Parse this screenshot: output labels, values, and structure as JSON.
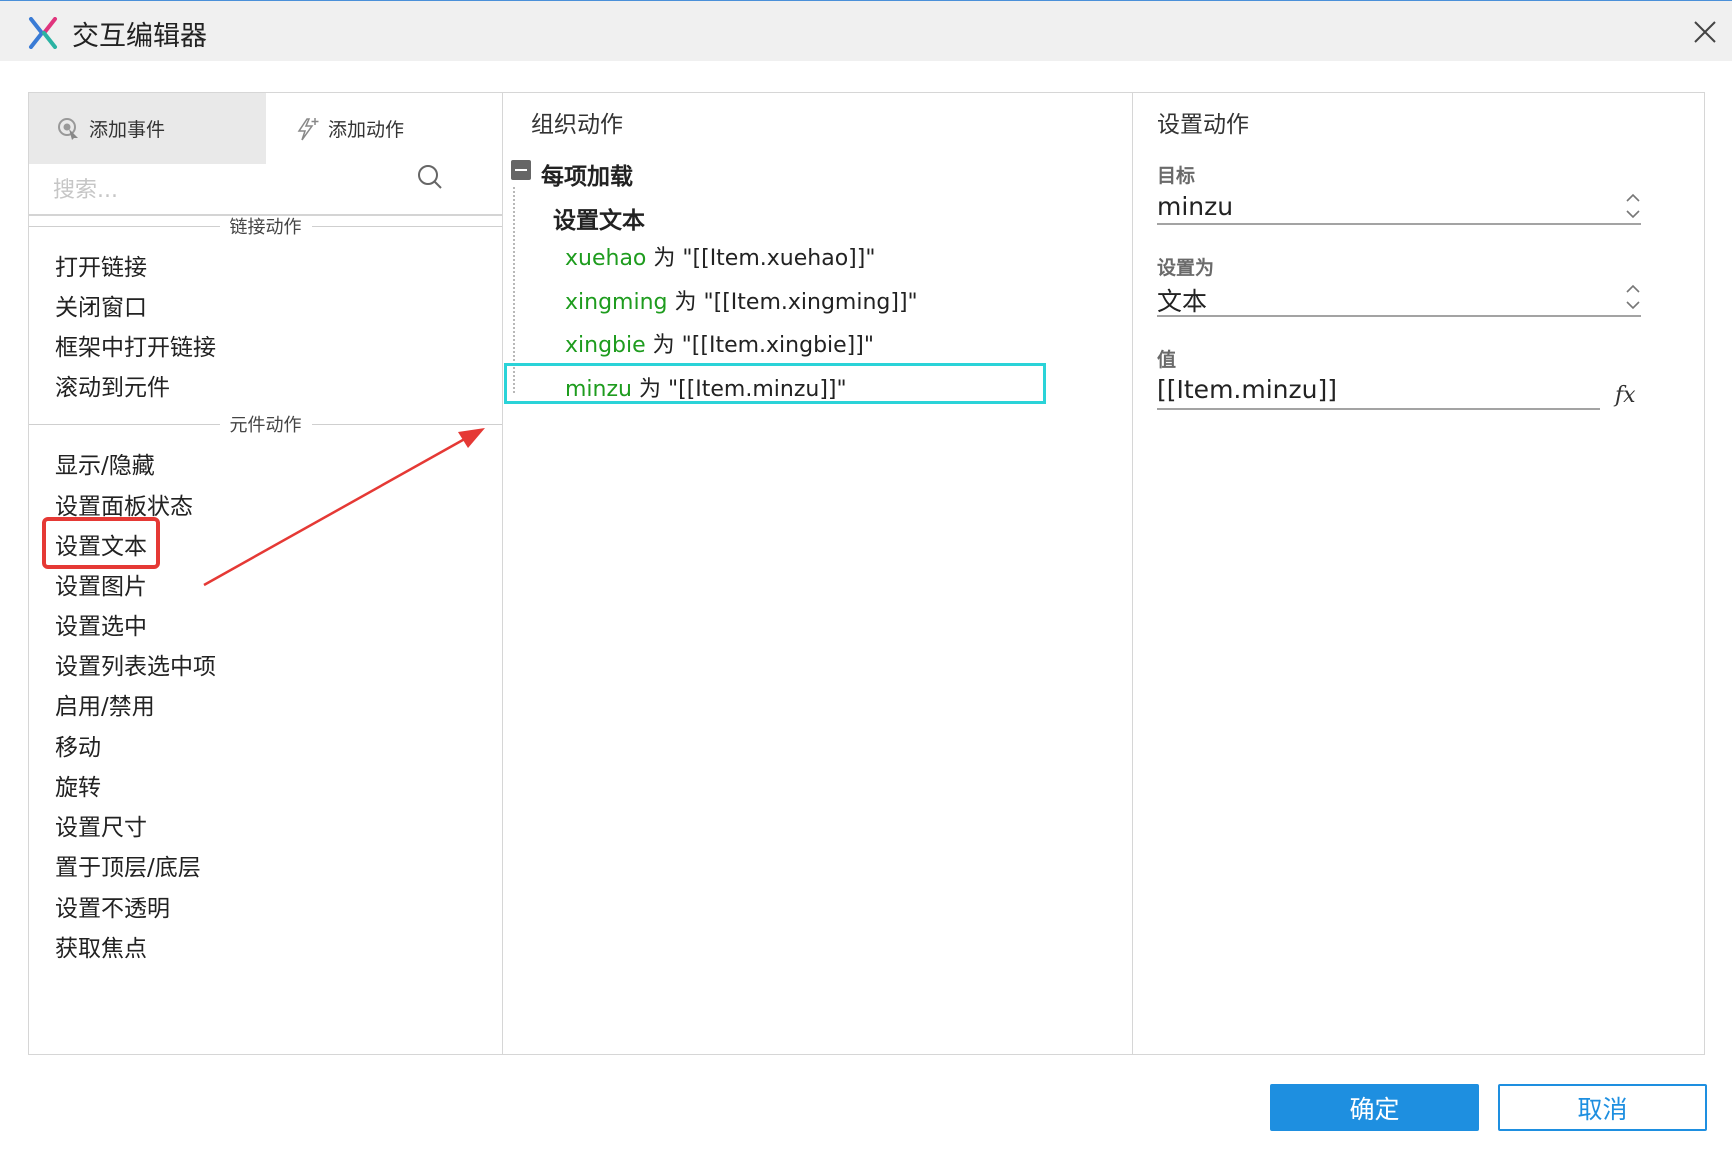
{
  "window": {
    "title": "交互编辑器",
    "logo_icon": "axure-x-icon",
    "close_icon": "close-icon"
  },
  "tabs": {
    "add_event": "添加事件",
    "add_action": "添加动作"
  },
  "search": {
    "placeholder": "搜索..."
  },
  "sections": {
    "link_actions": "链接动作",
    "widget_actions": "元件动作"
  },
  "link_actions": [
    "打开链接",
    "关闭窗口",
    "框架中打开链接",
    "滚动到元件"
  ],
  "widget_actions": [
    "显示/隐藏",
    "设置面板状态",
    "设置文本",
    "设置图片",
    "设置选中",
    "设置列表选中项",
    "启用/禁用",
    "移动",
    "旋转",
    "设置尺寸",
    "置于顶层/底层",
    "设置不透明",
    "获取焦点"
  ],
  "organize": {
    "header": "组织动作",
    "event_label": "每项加载",
    "action_label": "设置文本",
    "rows": [
      {
        "target": "xuehao",
        "word": "为",
        "value": "\"[[Item.xuehao]]\""
      },
      {
        "target": "xingming",
        "word": "为",
        "value": "\"[[Item.xingming]]\""
      },
      {
        "target": "xingbie",
        "word": "为",
        "value": "\"[[Item.xingbie]]\""
      },
      {
        "target": "minzu",
        "word": "为",
        "value": "\"[[Item.minzu]]\""
      }
    ],
    "selected_row_index": 3
  },
  "config": {
    "header": "设置动作",
    "target_label": "目标",
    "target_value": "minzu",
    "set_as_label": "设置为",
    "set_as_value": "文本",
    "value_label": "值",
    "value_value": "[[Item.minzu]]",
    "fx_label": "fx"
  },
  "buttons": {
    "ok": "确定",
    "cancel": "取消"
  },
  "colors": {
    "target_green": "#1e9c1e",
    "selection_cyan": "#2ad3d8",
    "annotation_red": "#e53935",
    "primary_blue": "#1e8fe0"
  }
}
